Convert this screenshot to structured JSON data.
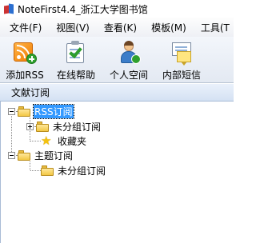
{
  "window": {
    "title": "NoteFirst4.4_浙江大学图书馆"
  },
  "menu": {
    "items": [
      {
        "label": "文件(F)"
      },
      {
        "label": "视图(V)"
      },
      {
        "label": "查看(K)"
      },
      {
        "label": "模板(M)"
      },
      {
        "label": "工具(T"
      }
    ]
  },
  "toolbar": {
    "add_rss": "添加RSS",
    "online_help": "在线帮助",
    "personal_space": "个人空间",
    "internal_message": "内部短信"
  },
  "panel": {
    "title": "文献订阅"
  },
  "tree": {
    "rss": {
      "label": "RSS订阅",
      "selected": true,
      "children": [
        {
          "label": "未分组订阅"
        },
        {
          "label": "收藏夹"
        }
      ]
    },
    "topic": {
      "label": "主题订阅",
      "children": [
        {
          "label": "未分组订阅"
        }
      ]
    }
  }
}
